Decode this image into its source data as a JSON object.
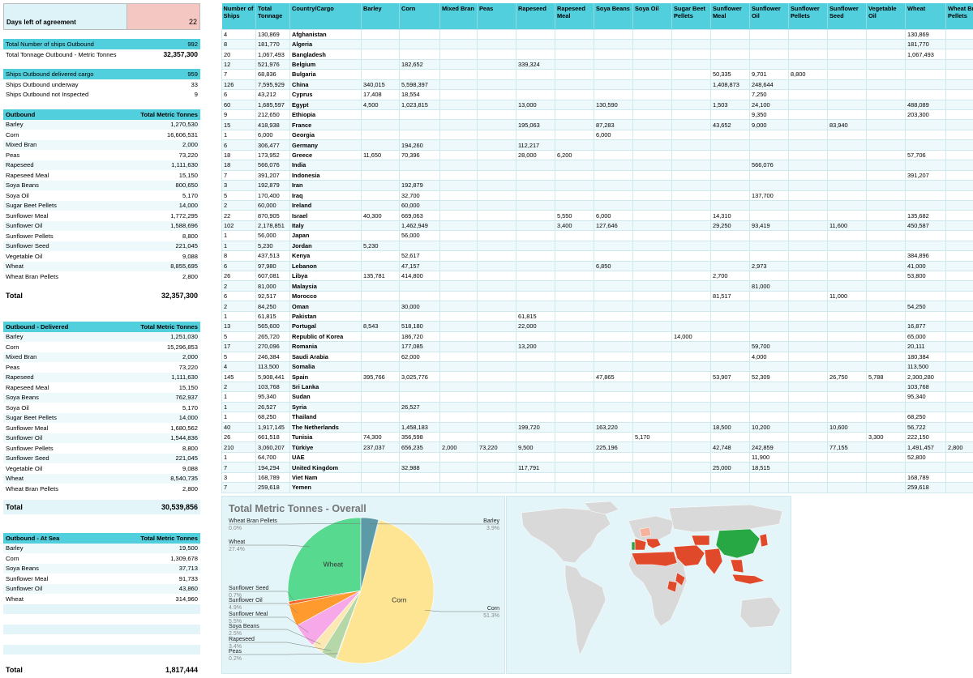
{
  "agreement": {
    "label": "Days left of agreement",
    "value": "22"
  },
  "summary": [
    {
      "label": "Total Number of ships Outbound",
      "value": "992",
      "style": "cyan"
    },
    {
      "label": "Total Tonnage Outbound - Metric Tonnes",
      "value": "32,357,300",
      "style": "bold"
    },
    {
      "label": "Ships Outbound delivered cargo",
      "value": "959",
      "style": "cyan"
    },
    {
      "label": "Ships Outbound underway",
      "value": "33",
      "style": ""
    },
    {
      "label": "Ships Outbound not Inspected",
      "value": "9",
      "style": ""
    }
  ],
  "outbound": {
    "title": "Outbound",
    "unit": "Total Metric Tonnes",
    "rows": [
      [
        "Barley",
        "1,270,530"
      ],
      [
        "Corn",
        "16,606,531"
      ],
      [
        "Mixed Bran",
        "2,000"
      ],
      [
        "Peas",
        "73,220"
      ],
      [
        "Rapeseed",
        "1,111,630"
      ],
      [
        "Rapeseed Meal",
        "15,150"
      ],
      [
        "Soya Beans",
        "800,650"
      ],
      [
        "Soya Oil",
        "5,170"
      ],
      [
        "Sugar Beet Pellets",
        "14,000"
      ],
      [
        "Sunflower Meal",
        "1,772,295"
      ],
      [
        "Sunflower Oil",
        "1,588,696"
      ],
      [
        "Sunflower Pellets",
        "8,800"
      ],
      [
        "Sunflower Seed",
        "221,045"
      ],
      [
        "Vegetable Oil",
        "9,088"
      ],
      [
        "Wheat",
        "8,855,695"
      ],
      [
        "Wheat Bran Pellets",
        "2,800"
      ]
    ],
    "total_label": "Total",
    "total": "32,357,300"
  },
  "delivered": {
    "title": "Outbound - Delivered",
    "unit": "Total Metric Tonnes",
    "rows": [
      [
        "Barley",
        "1,251,030"
      ],
      [
        "Corn",
        "15,296,853"
      ],
      [
        "Mixed Bran",
        "2,000"
      ],
      [
        "Peas",
        "73,220"
      ],
      [
        "Rapeseed",
        "1,111,630"
      ],
      [
        "Rapeseed Meal",
        "15,150"
      ],
      [
        "Soya Beans",
        "762,937"
      ],
      [
        "Soya Oil",
        "5,170"
      ],
      [
        "Sugar Beet Pellets",
        "14,000"
      ],
      [
        "Sunflower Meal",
        "1,680,562"
      ],
      [
        "Sunflower Oil",
        "1,544,836"
      ],
      [
        "Sunflower Pellets",
        "8,800"
      ],
      [
        "Sunflower Seed",
        "221,045"
      ],
      [
        "Vegetable Oil",
        "9,088"
      ],
      [
        "Wheat",
        "8,540,735"
      ],
      [
        "Wheat Bran Pellets",
        "2,800"
      ]
    ],
    "total_label": "Total",
    "total": "30,539,856"
  },
  "atsea": {
    "title": "Outbound - At Sea",
    "unit": "Total Metric Tonnes",
    "rows": [
      [
        "Barley",
        "19,500"
      ],
      [
        "Corn",
        "1,309,678"
      ],
      [
        "Soya Beans",
        "37,713"
      ],
      [
        "Sunflower Meal",
        "91,733"
      ],
      [
        "Sunflower Oil",
        "43,860"
      ],
      [
        "Wheat",
        "314,960"
      ]
    ],
    "blank_rows": 5,
    "total_label": "Total",
    "total": "1,817,444"
  },
  "grid": {
    "headers": [
      "Number of Ships",
      "Total Tonnage",
      "Country/Cargo",
      "Barley",
      "Corn",
      "Mixed Bran",
      "Peas",
      "Rapeseed",
      "Rapeseed Meal",
      "Soya Beans",
      "Soya Oil",
      "Sugar Beet Pellets",
      "Sunflower Meal",
      "Sunflower Oil",
      "Sunflower Pellets",
      "Sunflower Seed",
      "Vegetable Oil",
      "Wheat",
      "Wheat Bran Pellets"
    ],
    "rows": [
      [
        "4",
        "130,869",
        "Afghanistan",
        "",
        "",
        "",
        "",
        "",
        "",
        "",
        "",
        "",
        "",
        "",
        "",
        "",
        "",
        "130,869",
        ""
      ],
      [
        "8",
        "181,770",
        "Algeria",
        "",
        "",
        "",
        "",
        "",
        "",
        "",
        "",
        "",
        "",
        "",
        "",
        "",
        "",
        "181,770",
        ""
      ],
      [
        "20",
        "1,067,493",
        "Bangladesh",
        "",
        "",
        "",
        "",
        "",
        "",
        "",
        "",
        "",
        "",
        "",
        "",
        "",
        "",
        "1,067,493",
        ""
      ],
      [
        "12",
        "521,976",
        "Belgium",
        "",
        "182,652",
        "",
        "",
        "339,324",
        "",
        "",
        "",
        "",
        "",
        "",
        "",
        "",
        "",
        "",
        ""
      ],
      [
        "7",
        "68,836",
        "Bulgaria",
        "",
        "",
        "",
        "",
        "",
        "",
        "",
        "",
        "",
        "50,335",
        "9,701",
        "8,800",
        "",
        "",
        "",
        ""
      ],
      [
        "126",
        "7,595,929",
        "China",
        "340,015",
        "5,598,397",
        "",
        "",
        "",
        "",
        "",
        "",
        "",
        "1,408,873",
        "248,644",
        "",
        "",
        "",
        "",
        ""
      ],
      [
        "6",
        "43,212",
        "Cyprus",
        "17,408",
        "18,554",
        "",
        "",
        "",
        "",
        "",
        "",
        "",
        "",
        "7,250",
        "",
        "",
        "",
        "",
        ""
      ],
      [
        "60",
        "1,685,597",
        "Egypt",
        "4,500",
        "1,023,815",
        "",
        "",
        "13,000",
        "",
        "130,590",
        "",
        "",
        "1,503",
        "24,100",
        "",
        "",
        "",
        "488,089",
        ""
      ],
      [
        "9",
        "212,650",
        "Ethiopia",
        "",
        "",
        "",
        "",
        "",
        "",
        "",
        "",
        "",
        "",
        "9,350",
        "",
        "",
        "",
        "203,300",
        ""
      ],
      [
        "15",
        "418,938",
        "France",
        "",
        "",
        "",
        "",
        "195,063",
        "",
        "87,283",
        "",
        "",
        "43,652",
        "9,000",
        "",
        "83,940",
        "",
        "",
        ""
      ],
      [
        "1",
        "6,000",
        "Georgia",
        "",
        "",
        "",
        "",
        "",
        "",
        "6,000",
        "",
        "",
        "",
        "",
        "",
        "",
        "",
        "",
        ""
      ],
      [
        "6",
        "306,477",
        "Germany",
        "",
        "194,260",
        "",
        "",
        "112,217",
        "",
        "",
        "",
        "",
        "",
        "",
        "",
        "",
        "",
        "",
        ""
      ],
      [
        "18",
        "173,952",
        "Greece",
        "11,650",
        "70,396",
        "",
        "",
        "28,000",
        "6,200",
        "",
        "",
        "",
        "",
        "",
        "",
        "",
        "",
        "57,706",
        ""
      ],
      [
        "18",
        "566,076",
        "India",
        "",
        "",
        "",
        "",
        "",
        "",
        "",
        "",
        "",
        "",
        "566,076",
        "",
        "",
        "",
        "",
        ""
      ],
      [
        "7",
        "391,207",
        "Indonesia",
        "",
        "",
        "",
        "",
        "",
        "",
        "",
        "",
        "",
        "",
        "",
        "",
        "",
        "",
        "391,207",
        ""
      ],
      [
        "3",
        "192,879",
        "Iran",
        "",
        "192,879",
        "",
        "",
        "",
        "",
        "",
        "",
        "",
        "",
        "",
        "",
        "",
        "",
        "",
        ""
      ],
      [
        "5",
        "170,400",
        "Iraq",
        "",
        "32,700",
        "",
        "",
        "",
        "",
        "",
        "",
        "",
        "",
        "137,700",
        "",
        "",
        "",
        "",
        ""
      ],
      [
        "2",
        "60,000",
        "Ireland",
        "",
        "60,000",
        "",
        "",
        "",
        "",
        "",
        "",
        "",
        "",
        "",
        "",
        "",
        "",
        "",
        ""
      ],
      [
        "22",
        "870,905",
        "Israel",
        "40,300",
        "669,063",
        "",
        "",
        "",
        "5,550",
        "6,000",
        "",
        "",
        "14,310",
        "",
        "",
        "",
        "",
        "135,682",
        ""
      ],
      [
        "102",
        "2,178,851",
        "Italy",
        "",
        "1,462,949",
        "",
        "",
        "",
        "3,400",
        "127,646",
        "",
        "",
        "29,250",
        "93,419",
        "",
        "11,600",
        "",
        "450,587",
        ""
      ],
      [
        "1",
        "56,000",
        "Japan",
        "",
        "56,000",
        "",
        "",
        "",
        "",
        "",
        "",
        "",
        "",
        "",
        "",
        "",
        "",
        "",
        ""
      ],
      [
        "1",
        "5,230",
        "Jordan",
        "5,230",
        "",
        "",
        "",
        "",
        "",
        "",
        "",
        "",
        "",
        "",
        "",
        "",
        "",
        "",
        ""
      ],
      [
        "8",
        "437,513",
        "Kenya",
        "",
        "52,617",
        "",
        "",
        "",
        "",
        "",
        "",
        "",
        "",
        "",
        "",
        "",
        "",
        "384,896",
        ""
      ],
      [
        "6",
        "97,980",
        "Lebanon",
        "",
        "47,157",
        "",
        "",
        "",
        "",
        "6,850",
        "",
        "",
        "",
        "2,973",
        "",
        "",
        "",
        "41,000",
        ""
      ],
      [
        "26",
        "607,081",
        "Libya",
        "135,781",
        "414,800",
        "",
        "",
        "",
        "",
        "",
        "",
        "",
        "2,700",
        "",
        "",
        "",
        "",
        "53,800",
        ""
      ],
      [
        "2",
        "81,000",
        "Malaysia",
        "",
        "",
        "",
        "",
        "",
        "",
        "",
        "",
        "",
        "",
        "81,000",
        "",
        "",
        "",
        "",
        ""
      ],
      [
        "6",
        "92,517",
        "Morocco",
        "",
        "",
        "",
        "",
        "",
        "",
        "",
        "",
        "",
        "81,517",
        "",
        "",
        "11,000",
        "",
        "",
        ""
      ],
      [
        "2",
        "84,250",
        "Oman",
        "",
        "30,000",
        "",
        "",
        "",
        "",
        "",
        "",
        "",
        "",
        "",
        "",
        "",
        "",
        "54,250",
        ""
      ],
      [
        "1",
        "61,815",
        "Pakistan",
        "",
        "",
        "",
        "",
        "61,815",
        "",
        "",
        "",
        "",
        "",
        "",
        "",
        "",
        "",
        "",
        ""
      ],
      [
        "13",
        "565,600",
        "Portugal",
        "8,543",
        "518,180",
        "",
        "",
        "22,000",
        "",
        "",
        "",
        "",
        "",
        "",
        "",
        "",
        "",
        "16,877",
        ""
      ],
      [
        "5",
        "265,720",
        "Republic of Korea",
        "",
        "186,720",
        "",
        "",
        "",
        "",
        "",
        "",
        "14,000",
        "",
        "",
        "",
        "",
        "",
        "65,000",
        ""
      ],
      [
        "17",
        "270,096",
        "Romania",
        "",
        "177,085",
        "",
        "",
        "13,200",
        "",
        "",
        "",
        "",
        "",
        "59,700",
        "",
        "",
        "",
        "20,111",
        ""
      ],
      [
        "5",
        "246,384",
        "Saudi Arabia",
        "",
        "62,000",
        "",
        "",
        "",
        "",
        "",
        "",
        "",
        "",
        "4,000",
        "",
        "",
        "",
        "180,384",
        ""
      ],
      [
        "4",
        "113,500",
        "Somalia",
        "",
        "",
        "",
        "",
        "",
        "",
        "",
        "",
        "",
        "",
        "",
        "",
        "",
        "",
        "113,500",
        ""
      ],
      [
        "145",
        "5,908,441",
        "Spain",
        "395,766",
        "3,025,776",
        "",
        "",
        "",
        "",
        "47,865",
        "",
        "",
        "53,907",
        "52,309",
        "",
        "26,750",
        "5,788",
        "2,300,280",
        ""
      ],
      [
        "2",
        "103,768",
        "Sri Lanka",
        "",
        "",
        "",
        "",
        "",
        "",
        "",
        "",
        "",
        "",
        "",
        "",
        "",
        "",
        "103,768",
        ""
      ],
      [
        "1",
        "95,340",
        "Sudan",
        "",
        "",
        "",
        "",
        "",
        "",
        "",
        "",
        "",
        "",
        "",
        "",
        "",
        "",
        "95,340",
        ""
      ],
      [
        "1",
        "26,527",
        "Syria",
        "",
        "26,527",
        "",
        "",
        "",
        "",
        "",
        "",
        "",
        "",
        "",
        "",
        "",
        "",
        "",
        ""
      ],
      [
        "1",
        "68,250",
        "Thailand",
        "",
        "",
        "",
        "",
        "",
        "",
        "",
        "",
        "",
        "",
        "",
        "",
        "",
        "",
        "68,250",
        ""
      ],
      [
        "40",
        "1,917,145",
        "The Netherlands",
        "",
        "1,458,183",
        "",
        "",
        "199,720",
        "",
        "163,220",
        "",
        "",
        "18,500",
        "10,200",
        "",
        "10,600",
        "",
        "56,722",
        ""
      ],
      [
        "26",
        "661,518",
        "Tunisia",
        "74,300",
        "356,598",
        "",
        "",
        "",
        "",
        "",
        "5,170",
        "",
        "",
        "",
        "",
        "",
        "3,300",
        "222,150",
        ""
      ],
      [
        "210",
        "3,060,207",
        "Türkiye",
        "237,037",
        "656,235",
        "2,000",
        "73,220",
        "9,500",
        "",
        "225,196",
        "",
        "",
        "42,748",
        "242,859",
        "",
        "77,155",
        "",
        "1,491,457",
        "2,800"
      ],
      [
        "1",
        "64,700",
        "UAE",
        "",
        "",
        "",
        "",
        "",
        "",
        "",
        "",
        "",
        "",
        "11,900",
        "",
        "",
        "",
        "52,800",
        ""
      ],
      [
        "7",
        "194,294",
        "United Kingdom",
        "",
        "32,988",
        "",
        "",
        "117,791",
        "",
        "",
        "",
        "",
        "25,000",
        "18,515",
        "",
        "",
        "",
        "",
        ""
      ],
      [
        "3",
        "168,789",
        "Viet Nam",
        "",
        "",
        "",
        "",
        "",
        "",
        "",
        "",
        "",
        "",
        "",
        "",
        "",
        "",
        "168,789",
        ""
      ],
      [
        "7",
        "259,618",
        "Yemen",
        "",
        "",
        "",
        "",
        "",
        "",
        "",
        "",
        "",
        "",
        "",
        "",
        "",
        "",
        "259,618",
        ""
      ]
    ]
  },
  "chart_data": {
    "type": "pie",
    "title": "Total Metric Tonnes - Overall",
    "slices": [
      {
        "label": "Corn",
        "pct": "51.3%",
        "value": 51.3,
        "color": "#fde594"
      },
      {
        "label": "Peas",
        "pct": "0.2%",
        "value": 0.2,
        "color": "#b7e1cd"
      },
      {
        "label": "Rapeseed",
        "pct": "3.4%",
        "value": 3.4,
        "color": "#b6d7a8"
      },
      {
        "label": "Soya Beans",
        "pct": "2.5%",
        "value": 2.5,
        "color": "#fce8b2"
      },
      {
        "label": "Sunflower Meal",
        "pct": "5.5%",
        "value": 5.5,
        "color": "#f7a8e8"
      },
      {
        "label": "Sunflower Oil",
        "pct": "4.9%",
        "value": 4.9,
        "color": "#ff9a2e"
      },
      {
        "label": "Sunflower Seed",
        "pct": "0.7%",
        "value": 0.7,
        "color": "#f46524"
      },
      {
        "label": "Wheat",
        "pct": "27.4%",
        "value": 27.4,
        "color": "#57d98f"
      },
      {
        "label": "Wheat Bran Pellets",
        "pct": "0.0%",
        "value": 0.0,
        "color": "#8bc34a"
      },
      {
        "label": "Barley",
        "pct": "3.9%",
        "value": 3.9,
        "color": "#5b9aa6"
      }
    ],
    "other_share": 0.2,
    "other_color": "#cfe9ee",
    "legend": "callouts"
  },
  "map": {
    "colors": {
      "land": "#d9d9d9",
      "high": "#27a844",
      "mid": "#e04a2a",
      "low": "#f5b39e",
      "water": "#ffffff"
    }
  }
}
